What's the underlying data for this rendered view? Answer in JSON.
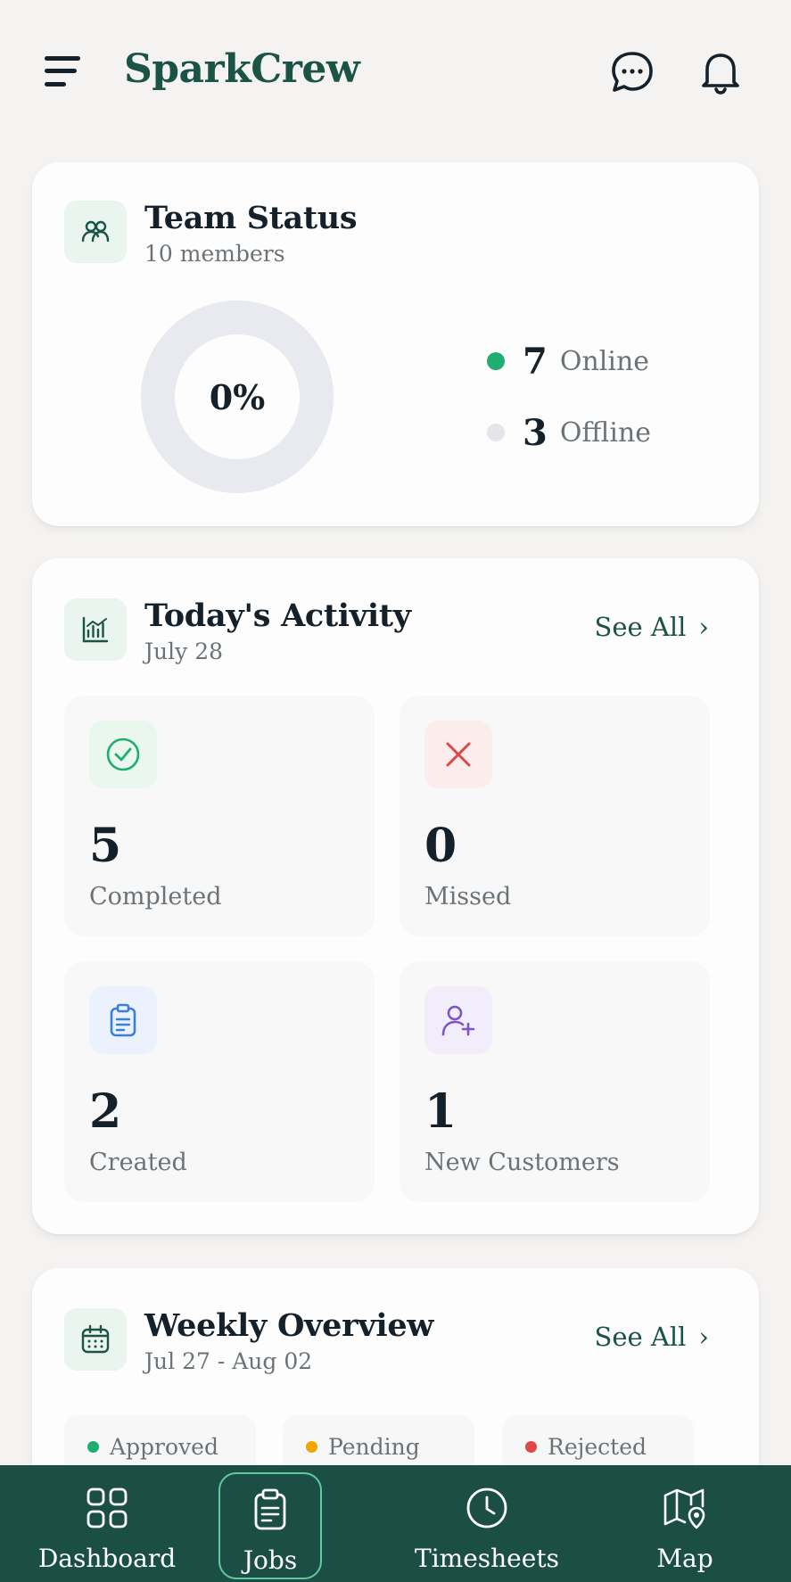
{
  "app": {
    "title": "SparkCrew"
  },
  "header": {
    "menu_icon": "menu-icon",
    "chat_icon": "chat-bubble-icon",
    "bell_icon": "bell-icon"
  },
  "team_status": {
    "title": "Team Status",
    "subtitle": "10 members",
    "icon": "users-icon",
    "donut_center": "0%",
    "online_count": "7",
    "online_label": "Online",
    "offline_count": "3",
    "offline_label": "Offline",
    "online_color": "#1fae6f",
    "offline_color": "#e3e5ea"
  },
  "activity": {
    "title": "Today's Activity",
    "subtitle": "July 28",
    "see_all": "See All",
    "icon": "bar-chart-icon",
    "tiles": [
      {
        "value": "5",
        "label": "Completed",
        "icon": "check-circle-icon",
        "color": "#1fae6f",
        "bg": "#e9f7ef"
      },
      {
        "value": "0",
        "label": "Missed",
        "icon": "x-icon",
        "color": "#d94a4a",
        "bg": "#fdecec"
      },
      {
        "value": "2",
        "label": "Created",
        "icon": "clipboard-icon",
        "color": "#3b7fd6",
        "bg": "#ebf2fd"
      },
      {
        "value": "1",
        "label": "New Customers",
        "icon": "user-plus-icon",
        "color": "#7c55c9",
        "bg": "#f2edfb"
      }
    ]
  },
  "weekly": {
    "title": "Weekly Overview",
    "subtitle": "Jul 27 - Aug 02",
    "see_all": "See All",
    "icon": "calendar-icon",
    "statuses": [
      {
        "label": "Approved",
        "color": "#1fae6f"
      },
      {
        "label": "Pending",
        "color": "#f0a500"
      },
      {
        "label": "Rejected",
        "color": "#e04848"
      }
    ]
  },
  "bottom_nav": {
    "items": [
      {
        "label": "Dashboard",
        "icon": "grid-icon"
      },
      {
        "label": "Jobs",
        "icon": "clipboard-icon",
        "active": true
      },
      {
        "label": "Timesheets",
        "icon": "clock-icon"
      },
      {
        "label": "Map",
        "icon": "map-pin-icon"
      }
    ]
  }
}
